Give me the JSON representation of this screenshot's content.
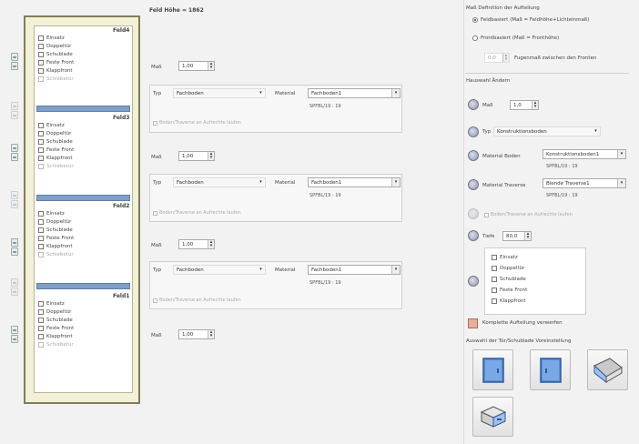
{
  "header": {
    "title": "Feld Höhe = 1862"
  },
  "cabinet": {
    "fields": [
      {
        "title": "Feld4",
        "options": [
          "Einsatz",
          "Doppeltür",
          "Schublade",
          "Feste Front",
          "Klappfront",
          "Schiebetür"
        ]
      },
      {
        "title": "Feld3",
        "options": [
          "Einsatz",
          "Doppeltür",
          "Schublade",
          "Feste Front",
          "Klappfront",
          "Schiebetür"
        ]
      },
      {
        "title": "Feld2",
        "options": [
          "Einsatz",
          "Doppeltür",
          "Schublade",
          "Feste Front",
          "Klappfront",
          "Schiebetür"
        ]
      },
      {
        "title": "Feld1",
        "options": [
          "Einsatz",
          "Doppeltür",
          "Schublade",
          "Feste Front",
          "Klappfront",
          "Schiebetür"
        ]
      }
    ]
  },
  "middle": {
    "mass_label": "Maß",
    "mass_values": [
      "1,00",
      "1,00",
      "1,00",
      "1,00"
    ],
    "groups": [
      {
        "typ_label": "Typ",
        "typ_value": "Fachboden",
        "material_label": "Material",
        "material_value": "Fachboden1",
        "spec": "SPFBL/19 : 19",
        "check_label": "Boden/Traverse an Aufrechte laufen"
      },
      {
        "typ_label": "Typ",
        "typ_value": "Fachboden",
        "material_label": "Material",
        "material_value": "Fachboden1",
        "spec": "SPFBL/19 : 19",
        "check_label": "Boden/Traverse an Aufrechte laufen"
      },
      {
        "typ_label": "Typ",
        "typ_value": "Fachboden",
        "material_label": "Material",
        "material_value": "Fachboden1",
        "spec": "SPFBL/19 : 19",
        "check_label": "Boden/Traverse an Aufrechte laufen"
      }
    ]
  },
  "right": {
    "definition_title": "Maß Definition der Aufteilung",
    "radio_1": "Feldbasiert (Maß = Feldhöhe+Lichteinmaß)",
    "radio_2": "Frontbasiert (Maß = Fronthöhe)",
    "fuge_value": "0,0",
    "fuge_label": "Fugenmaß zwischen den Fronten",
    "section_title": "Hauswahl Ändern",
    "mass_label": "Maß",
    "mass_value": "1,0",
    "typ_label": "Typ",
    "typ_value": "Konstruktionsboden",
    "mat_boden_label": "Material Boden",
    "mat_boden_value": "Konstruktionsboden1",
    "mat_boden_spec": "SPFBL/19 : 19",
    "mat_traverse_label": "Material Traverse",
    "mat_traverse_value": "Blende Traverse1",
    "mat_traverse_spec": "SPFBL/19 : 19",
    "boden_check_label": "Boden/Traverse an Aufrechte laufen",
    "tiefe_label": "Tiefe",
    "tiefe_value": "80,0",
    "options": [
      "Einsatz",
      "Doppeltür",
      "Schublade",
      "Feste Front",
      "Klappfront"
    ],
    "discard_label": "Komplette Aufteilung verwerfen",
    "choose_title": "Auswahl der Tür/Schublade Voreinstellung"
  },
  "icons": [
    "gear-icon",
    "door-left-icon",
    "door-right-icon",
    "flap-icon",
    "drawer-icon",
    "discard-icon"
  ]
}
